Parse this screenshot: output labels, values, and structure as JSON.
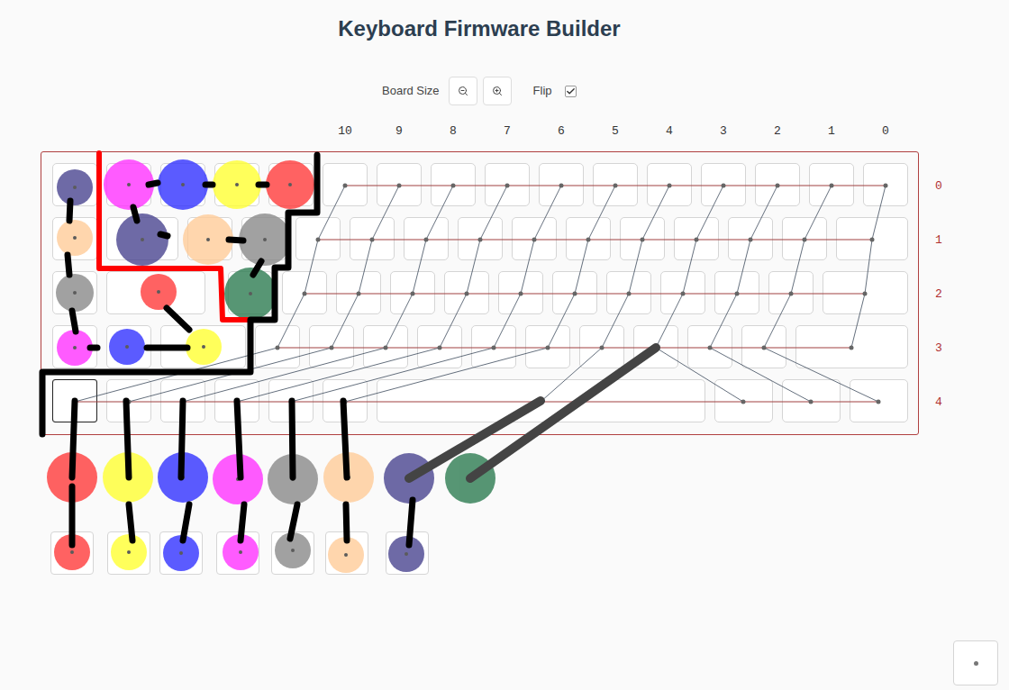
{
  "title": "Keyboard Firmware Builder",
  "toolbar": {
    "board_size_label": "Board Size",
    "flip": {
      "label": "Flip",
      "checked": true
    }
  },
  "column_labels": [
    "10",
    "9",
    "8",
    "7",
    "6",
    "5",
    "4",
    "3",
    "2",
    "1",
    "0"
  ],
  "row_labels": [
    "0",
    "1",
    "2",
    "3",
    "4"
  ],
  "markers": [
    {
      "color": "#4a4590"
    },
    {
      "color": "#ff33ff"
    },
    {
      "color": "#3333ff"
    },
    {
      "color": "#ffff33"
    },
    {
      "color": "#ff3b3b"
    },
    {
      "color": "#ffcc99"
    },
    {
      "color": "#4a4590"
    },
    {
      "color": "#ffcc99"
    },
    {
      "color": "#8a8a8a"
    },
    {
      "color": "#8a8a8a"
    },
    {
      "color": "#ff3b3b"
    },
    {
      "color": "#2e7d52"
    },
    {
      "color": "#ff33ff"
    },
    {
      "color": "#3333ff"
    },
    {
      "color": "#ffff33"
    },
    {
      "color": "#ff3b3b"
    },
    {
      "color": "#ffff33"
    },
    {
      "color": "#3333ff"
    },
    {
      "color": "#ff33ff"
    },
    {
      "color": "#8a8a8a"
    },
    {
      "color": "#ffcc99"
    },
    {
      "color": "#4a4590"
    },
    {
      "color": "#2e7d52"
    },
    {
      "color": "#ff3b3b"
    },
    {
      "color": "#ffff33"
    },
    {
      "color": "#3333ff"
    },
    {
      "color": "#ff33ff"
    },
    {
      "color": "#8a8a8a"
    },
    {
      "color": "#ffcc99"
    },
    {
      "color": "#4a4590"
    }
  ]
}
